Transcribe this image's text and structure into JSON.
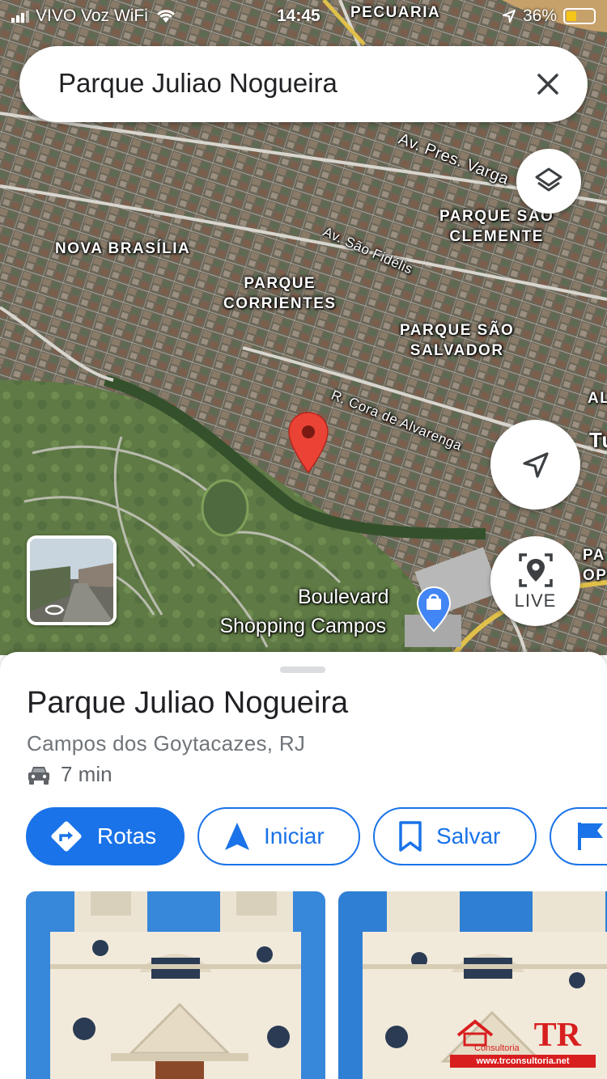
{
  "status_bar": {
    "carrier": "VIVO Voz WiFi",
    "time": "14:45",
    "battery": "36%",
    "battery_level": 0.36
  },
  "search": {
    "query": "Parque Juliao Nogueira"
  },
  "map": {
    "districts": [
      {
        "lines": [
          "PECUARIA"
        ]
      },
      {
        "lines": [
          "NOVA BRASÍLIA"
        ]
      },
      {
        "lines": [
          "PARQUE",
          "CORRIENTES"
        ]
      },
      {
        "lines": [
          "PARQUE SÃO",
          "CLEMENTE"
        ]
      },
      {
        "lines": [
          "PARQUE SÃO",
          "SALVADOR"
        ]
      },
      {
        "lines": [
          "AL"
        ]
      },
      {
        "lines": [
          "PA",
          "OP"
        ]
      },
      {
        "lines": [
          "Tu"
        ]
      }
    ],
    "streets": [
      {
        "name": "Av. Pres. Varga"
      },
      {
        "name": "Av. São Fidélis"
      },
      {
        "name": "R. Cora de Alvarenga"
      }
    ],
    "poi": {
      "name_line1": "Boulevard",
      "name_line2": "Shopping Campos",
      "icon": "shopping-bag-icon"
    },
    "live_label": "LIVE"
  },
  "place": {
    "title": "Parque Juliao Nogueira",
    "address": "Campos dos Goytacazes, RJ",
    "drive_time": "7 min"
  },
  "actions": [
    {
      "label": "Rotas",
      "icon": "directions-icon"
    },
    {
      "label": "Iniciar",
      "icon": "navigation-arrow-icon"
    },
    {
      "label": "Salvar",
      "icon": "bookmark-icon"
    },
    {
      "label": "",
      "icon": "flag-icon"
    }
  ],
  "watermark": {
    "brand": "TR",
    "small": "Consultoria",
    "url": "www.trconsultoria.net"
  },
  "colors": {
    "accent": "#1a73e8",
    "pin": "#ea4335"
  }
}
